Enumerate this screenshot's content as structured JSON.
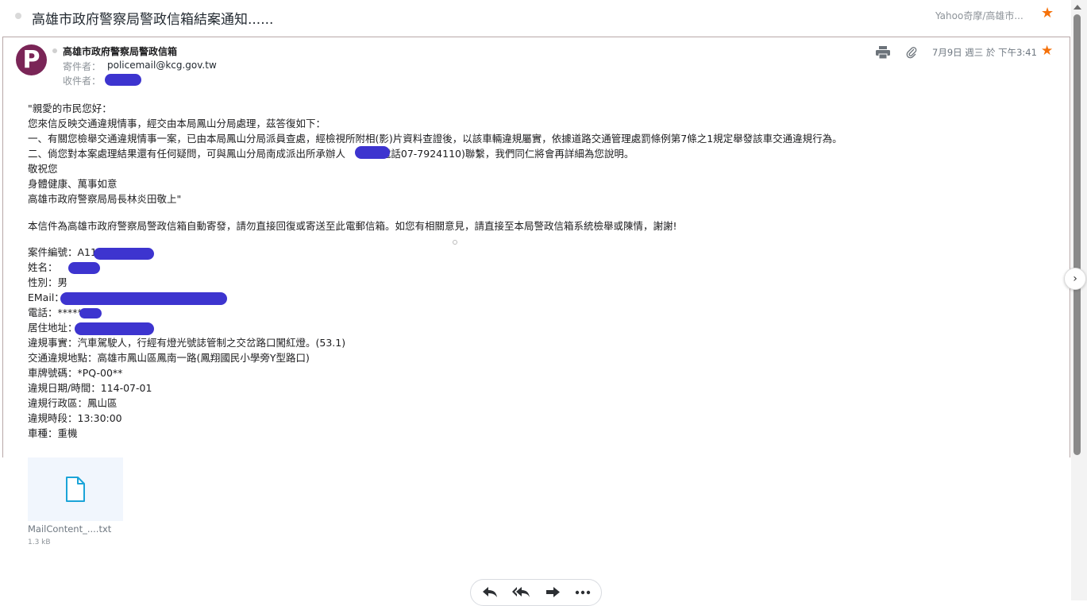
{
  "header": {
    "subject": "高雄市政府警察局警政信箱結案通知......",
    "folder": "Yahoo奇摩/高雄市..."
  },
  "message": {
    "sender_name": "高雄市政府警察局警政信箱",
    "from_label": "寄件者：",
    "from_address": "policemail@kcg.gov.tw",
    "to_label": "收件者：",
    "date": "7月9日 週三 於 下午3:41",
    "avatar_letter": "P",
    "avatar_color": "#7a2557",
    "accent_star_color": "#f5710a"
  },
  "body": {
    "lines_1": [
      "\"親愛的市民您好：",
      "您來信反映交通違規情事，經交由本局鳳山分局處理，茲答復如下：",
      "一、有關您檢舉交通違規情事一案，已由本局鳳山分局派員查處，經檢視所附相(影)片資料查證後，以該車輛違規屬實，依據道路交通管理處罰條例第7條之1規定舉發該車交通違規行為。",
      "二、倘您對本案處理結果還有任何疑問，可與鳳山分局南成派出所承辦人",
      "敬祝您",
      "身體健康、萬事如意",
      "高雄市政府警察局局長林炎田敬上\""
    ],
    "line_2_tail": "(電話07-7924110)聯繫，我們同仁將會再詳細為您說明。",
    "notice": "本信件為高雄市政府警察局警政信箱自動寄發，請勿直接回復或寄送至此電郵信箱。如您有相關意見，請直接至本局警政信箱系統檢舉或陳情，謝謝!",
    "fields": [
      "案件編號：A114",
      "姓名：",
      "性別：男",
      "EMail：",
      "電話：*****",
      "居住地址：",
      "違規事實：汽車駕駛人，行經有燈光號誌管制之交岔路口闖紅燈。(53.1)",
      "交通違規地點：高雄市鳳山區鳳南一路(鳳翔國民小學旁Y型路口)",
      "車牌號碼：*PQ-00**",
      "違規日期/時間：114-07-01",
      "違規行政區：鳳山區",
      "違規時段：13:30:00",
      "車種：重機"
    ]
  },
  "attachment": {
    "name": "MailContent_....txt",
    "size": "1.3 kB",
    "icon": "text-file-icon",
    "icon_color": "#1ba4d8"
  },
  "toolbar": {
    "reply": "reply-icon",
    "reply_all": "reply-all-icon",
    "forward": "forward-icon",
    "more": "more-icon"
  },
  "redaction_color": "#3d34cf"
}
